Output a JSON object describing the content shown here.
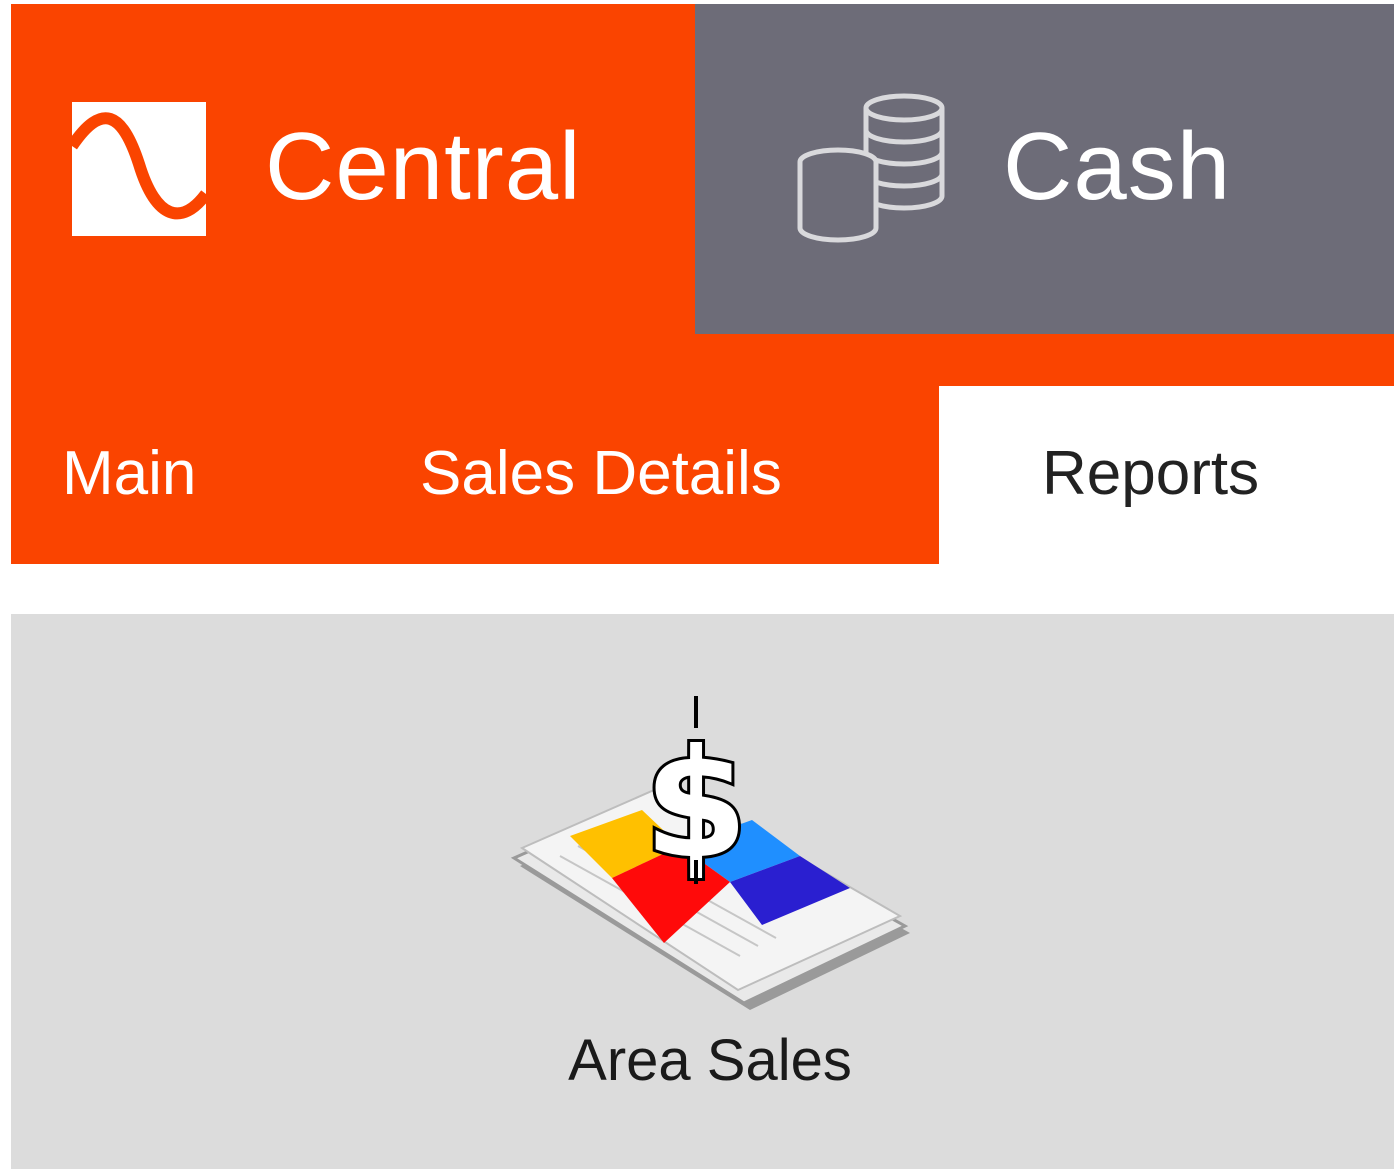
{
  "colors": {
    "brand_orange": "#fa4400",
    "header_gray": "#6d6c78",
    "content_gray": "#dcdcdc",
    "active_tab_bg": "#ffffff"
  },
  "header": {
    "app_name": "Central",
    "app_icon": "central-logo-icon",
    "section_name": "Cash",
    "section_icon": "coins-icon"
  },
  "tabs": [
    {
      "label": "Main",
      "active": false
    },
    {
      "label": "Sales Details",
      "active": false
    },
    {
      "label": "Reports",
      "active": true
    }
  ],
  "reports": {
    "items": [
      {
        "label": "Area Sales",
        "icon": "area-sales-icon"
      }
    ]
  }
}
